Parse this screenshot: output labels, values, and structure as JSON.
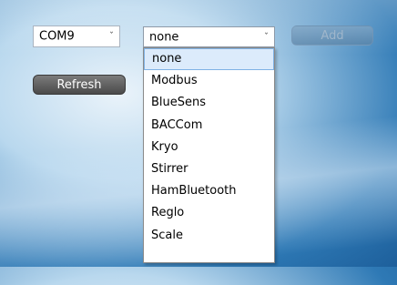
{
  "port_select": {
    "value": "COM9",
    "arrow_icon": "chevron-down-icon"
  },
  "device_select": {
    "value": "none",
    "arrow_icon": "chevron-down-icon"
  },
  "add_button": {
    "label": "Add"
  },
  "refresh_button": {
    "label": "Refresh"
  },
  "dropdown": {
    "selected_index": 0,
    "options": [
      "none",
      "Modbus",
      "BlueSens",
      "BACCom",
      "Kryo",
      "Stirrer",
      "HamBluetooth",
      "Reglo",
      "Scale"
    ]
  },
  "colors": {
    "highlight": "#dcebfb",
    "highlight_border": "#7fb2e5",
    "background": "#2e79b5"
  }
}
